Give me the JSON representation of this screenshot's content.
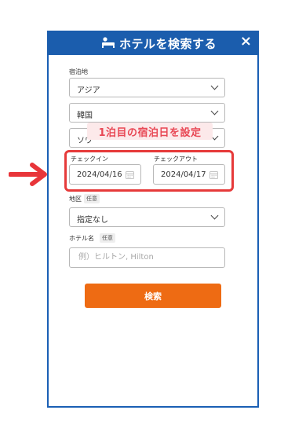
{
  "header": {
    "title": "ホテルを検索する",
    "close_icon": "×"
  },
  "destination": {
    "label": "宿泊地",
    "region": "アジア",
    "country": "韓国",
    "city": "ソウ"
  },
  "annotation": {
    "callout": "1泊目の宿泊日を設定",
    "color": "#e63a3a"
  },
  "checkin": {
    "label": "チェックイン",
    "value": "2024/04/16"
  },
  "checkout": {
    "label": "チェックアウト",
    "value": "2024/04/17"
  },
  "district": {
    "label": "地区",
    "badge": "任意",
    "value": "指定なし"
  },
  "hotel_name": {
    "label": "ホテル名",
    "badge": "任意",
    "placeholder": "例）ヒルトン, Hilton"
  },
  "search_button": {
    "label": "検索",
    "color": "#ee6b13"
  },
  "colors": {
    "header": "#1b5dad",
    "accent": "#ee6b13",
    "highlight": "#e63a3a"
  }
}
